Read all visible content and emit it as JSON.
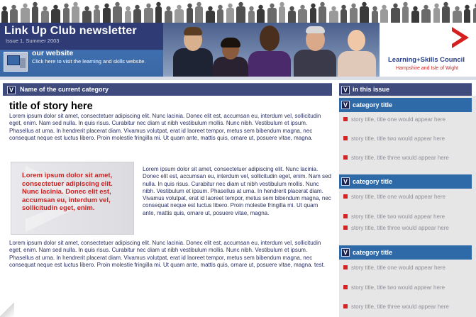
{
  "header": {
    "title": "Link Up Club newsletter",
    "issue": "Issue 1, Summer 2003",
    "website_title": "our website",
    "website_text": "Click here to visit the learning and skills website.",
    "council_name": "Learning+Skills Council",
    "council_region": "Hampshire and Isle of Wight"
  },
  "main": {
    "category_badge": "V",
    "category_label": "Name of the current category",
    "story_title": "title of story here",
    "paragraph_1": "Lorem ipsum dolor sit amet, consectetuer adipiscing elit. Nunc lacinia. Donec elit est, accumsan eu, interdum vel, sollicitudin eget, enim. Nam sed nulla. In quis risus. Curabitur nec diam ut nibh vestibulum mollis. Nunc nibh. Vestibulum et ipsum. Phasellus at urna. In hendrerit placerat diam. Vivamus volutpat, erat id laoreet tempor, metus sem bibendum magna, nec consequat neque est luctus libero. Proin molestie fringilla mi. Ut quam ante, mattis quis, ornare ut, posuere vitae, magna.",
    "pull_quote": "Lorem ipsum dolor sit amet, consectetuer adipiscing elit. Nunc lacinia. Donec elit est, accumsan eu, interdum vel, sollicitudin eget, enim.",
    "paragraph_2": "Lorem ipsum dolor sit amet, consectetuer adipiscing elit. Nunc lacinia. Donec elit est, accumsan eu, interdum vel, sollicitudin eget, enim. Nam sed nulla. In quis risus. Curabitur nec diam ut nibh vestibulum mollis. Nunc nibh. Vestibulum et ipsum. Phasellus at urna. In hendrerit placerat diam. Vivamus volutpat, erat id laoreet tempor, metus sem bibendum magna, nec consequat neque est luctus libero. Proin molestie fringilla mi. Ut quam ante, mattis quis, ornare ut, posuere vitae, magna.",
    "paragraph_3": "Lorem ipsum dolor sit amet, consectetuer adipiscing elit. Nunc lacinia. Donec elit est, accumsan eu, interdum vel, sollicitudin eget, enim. Nam sed nulla. In quis risus. Curabitur nec diam ut nibh vestibulum mollis. Nunc nibh. Vestibulum et ipsum. Phasellus at urna. In hendrerit placerat diam. Vivamus volutpat, erat id laoreet tempor, metus sem bibendum magna, nec consequat neque est luctus libero. Proin molestie fringilla mi. Ut quam ante, mattis quis, ornare ut, posuere vitae, magna. test."
  },
  "sidebar": {
    "badge": "V",
    "heading": "in this issue",
    "categories": [
      {
        "title": "category title",
        "items": [
          "story title, title one would appear here",
          "story title, title two would appear here",
          "story title, title three would appear here"
        ]
      },
      {
        "title": "category title",
        "items": [
          "story title, title one would appear here",
          "story title, title two would appear here",
          "story title, title three would appear here"
        ]
      },
      {
        "title": "category title",
        "items": [
          "story title, title one would appear here",
          "story title, title two would appear here",
          "story title, title three would appear here"
        ]
      }
    ]
  },
  "colors": {
    "navy": "#2a3566",
    "category_bar": "#3f4b7c",
    "sidebar_category": "#2f6aa8",
    "accent_red": "#cc2222",
    "body_text": "#2a3060"
  },
  "icons": {
    "website": "monitor-icon",
    "council_logo": "chevron-logo-icon",
    "badge": "v-badge-icon",
    "bullet": "square-bullet-icon"
  }
}
